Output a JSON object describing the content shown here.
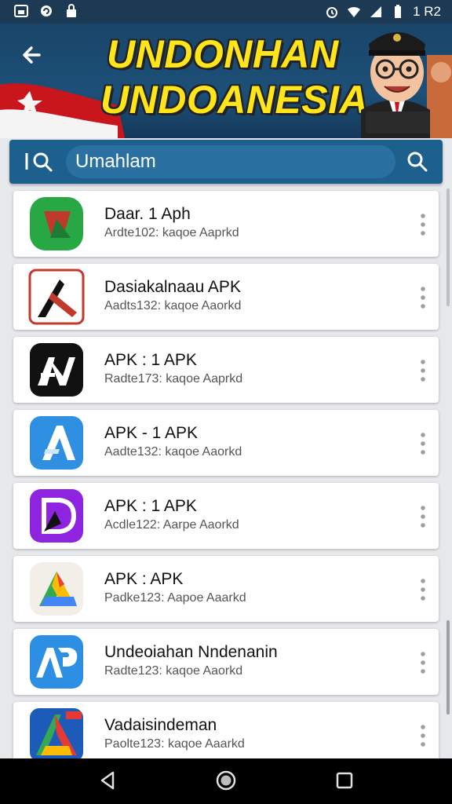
{
  "status_bar": {
    "time": "1 R2"
  },
  "header": {
    "banner_line1": "UNDONHAN",
    "banner_line2": "UNDOANESIA"
  },
  "search": {
    "value": "Umahlam"
  },
  "apps": [
    {
      "name": "Daar. 1 Aph",
      "meta": "Ardte102: kaqoe Aaprkd",
      "icon": "green-app-icon"
    },
    {
      "name": "Dasiakalnaau APK",
      "meta": "Aadts132: kaqoe Aaorkd",
      "icon": "red-x-app-icon"
    },
    {
      "name": "APK : 1 APK",
      "meta": "Radte173: kaqoe Aaprkd",
      "icon": "black-av-app-icon"
    },
    {
      "name": "APK - 1 APK",
      "meta": "Aadte132: kaqoe Aaorkd",
      "icon": "blue-a-app-icon"
    },
    {
      "name": "APK : 1 APK",
      "meta": "Acdle122: Aarpe Aaorkd",
      "icon": "purple-d-app-icon"
    },
    {
      "name": "APK : APK",
      "meta": "Padke123: Aapoe Aaarkd",
      "icon": "multicolor-a-app-icon"
    },
    {
      "name": "Undeoiahan Nndenanin",
      "meta": "Radte123: kaqoe Aaorkd",
      "icon": "blue-ap-app-icon"
    },
    {
      "name": "Vadaisindeman",
      "meta": "Paolte123: kaqoe Aaarkd",
      "icon": "multicolor-a2-app-icon"
    }
  ]
}
